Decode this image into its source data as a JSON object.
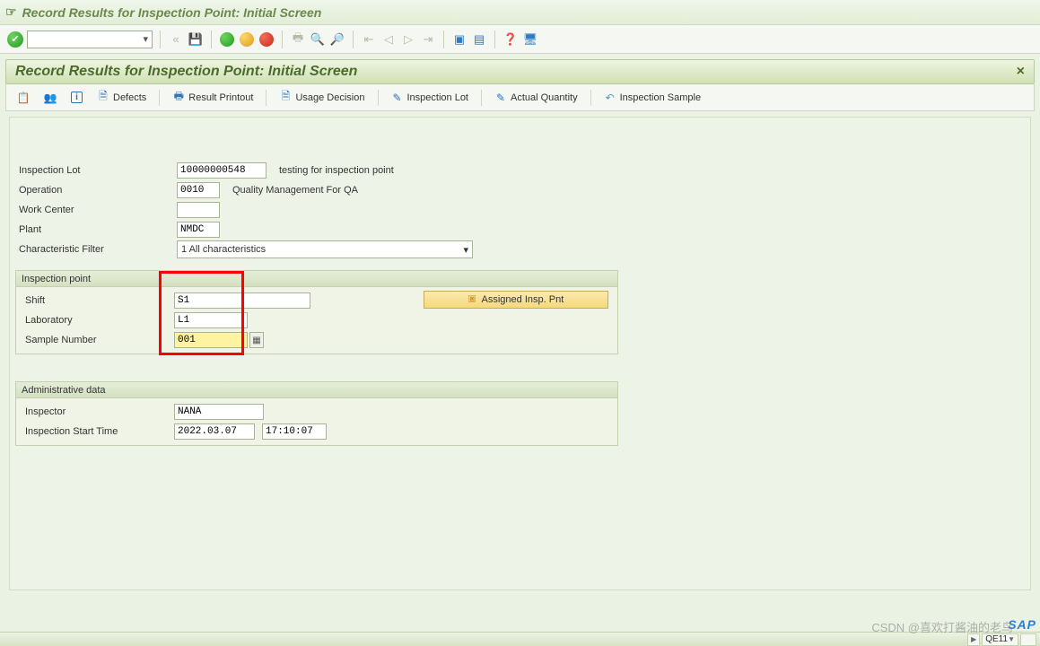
{
  "window_title": "Record Results for Inspection Point: Initial Screen",
  "screen_title": "Record Results for Inspection Point: Initial Screen",
  "app_toolbar": {
    "defects": "Defects",
    "result_printout": "Result Printout",
    "usage_decision": "Usage Decision",
    "inspection_lot": "Inspection Lot",
    "actual_quantity": "Actual Quantity",
    "inspection_sample": "Inspection Sample"
  },
  "form": {
    "inspection_lot_label": "Inspection Lot",
    "inspection_lot_value": "10000000548",
    "inspection_lot_desc": "testing for inspection point",
    "operation_label": "Operation",
    "operation_value": "0010",
    "operation_desc": "Quality Management For QA",
    "work_center_label": "Work Center",
    "work_center_value": "",
    "plant_label": "Plant",
    "plant_value": "NMDC",
    "char_filter_label": "Characteristic Filter",
    "char_filter_value": "1 All characteristics"
  },
  "inspection_point": {
    "group_title": "Inspection point",
    "shift_label": "Shift",
    "shift_value": "S1",
    "laboratory_label": "Laboratory",
    "laboratory_value": "L1",
    "sample_number_label": "Sample Number",
    "sample_number_value": "001",
    "assigned_btn": "Assigned Insp. Pnt"
  },
  "admin": {
    "group_title": "Administrative data",
    "inspector_label": "Inspector",
    "inspector_value": "NANA",
    "start_time_label": "Inspection Start Time",
    "start_date": "2022.03.07",
    "start_time": "17:10:07"
  },
  "footer": {
    "sap": "SAP",
    "tcode": "QE11",
    "watermark": "CSDN @喜欢打酱油的老鸟"
  }
}
